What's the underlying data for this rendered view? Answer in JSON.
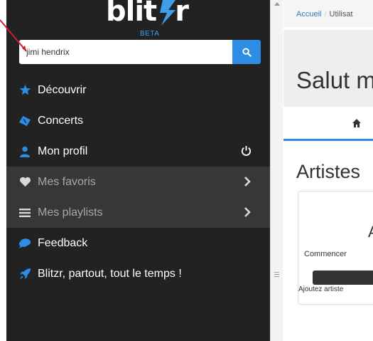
{
  "sidebar": {
    "logo_text": "blit",
    "logo_tail": "r",
    "logo_badge": "BETA",
    "search": {
      "value": "jimi hendrix",
      "button_icon": "search-icon"
    },
    "items": [
      {
        "label": "Découvrir",
        "icon": "star-icon"
      },
      {
        "label": "Concerts",
        "icon": "ticket-icon"
      },
      {
        "label": "Mon profil",
        "icon": "user-icon",
        "right_icon": "power-icon"
      },
      {
        "label": "Mes favoris",
        "icon": "heart-icon",
        "right_icon": "chevron-right-icon"
      },
      {
        "label": "Mes playlists",
        "icon": "list-icon",
        "right_icon": "chevron-right-icon"
      },
      {
        "label": "Feedback",
        "icon": "comments-icon"
      },
      {
        "label": "Blitzr, partout, tout le temps !",
        "icon": "rocket-icon"
      }
    ]
  },
  "main": {
    "breadcrumb": {
      "home": "Accueil",
      "separator": "/",
      "current": "Utilisat"
    },
    "hero_title": "Salut m",
    "tab_icon": "home-icon",
    "section_title": "Artistes",
    "card": {
      "letter": "A",
      "text": "Commencer",
      "footer": "Ajoutez artiste"
    }
  },
  "colors": {
    "sidebar_bg": "#222222",
    "accent": "#2d8ce3",
    "muted_row_bg": "#373737",
    "annotation": "#cc1f2d"
  }
}
